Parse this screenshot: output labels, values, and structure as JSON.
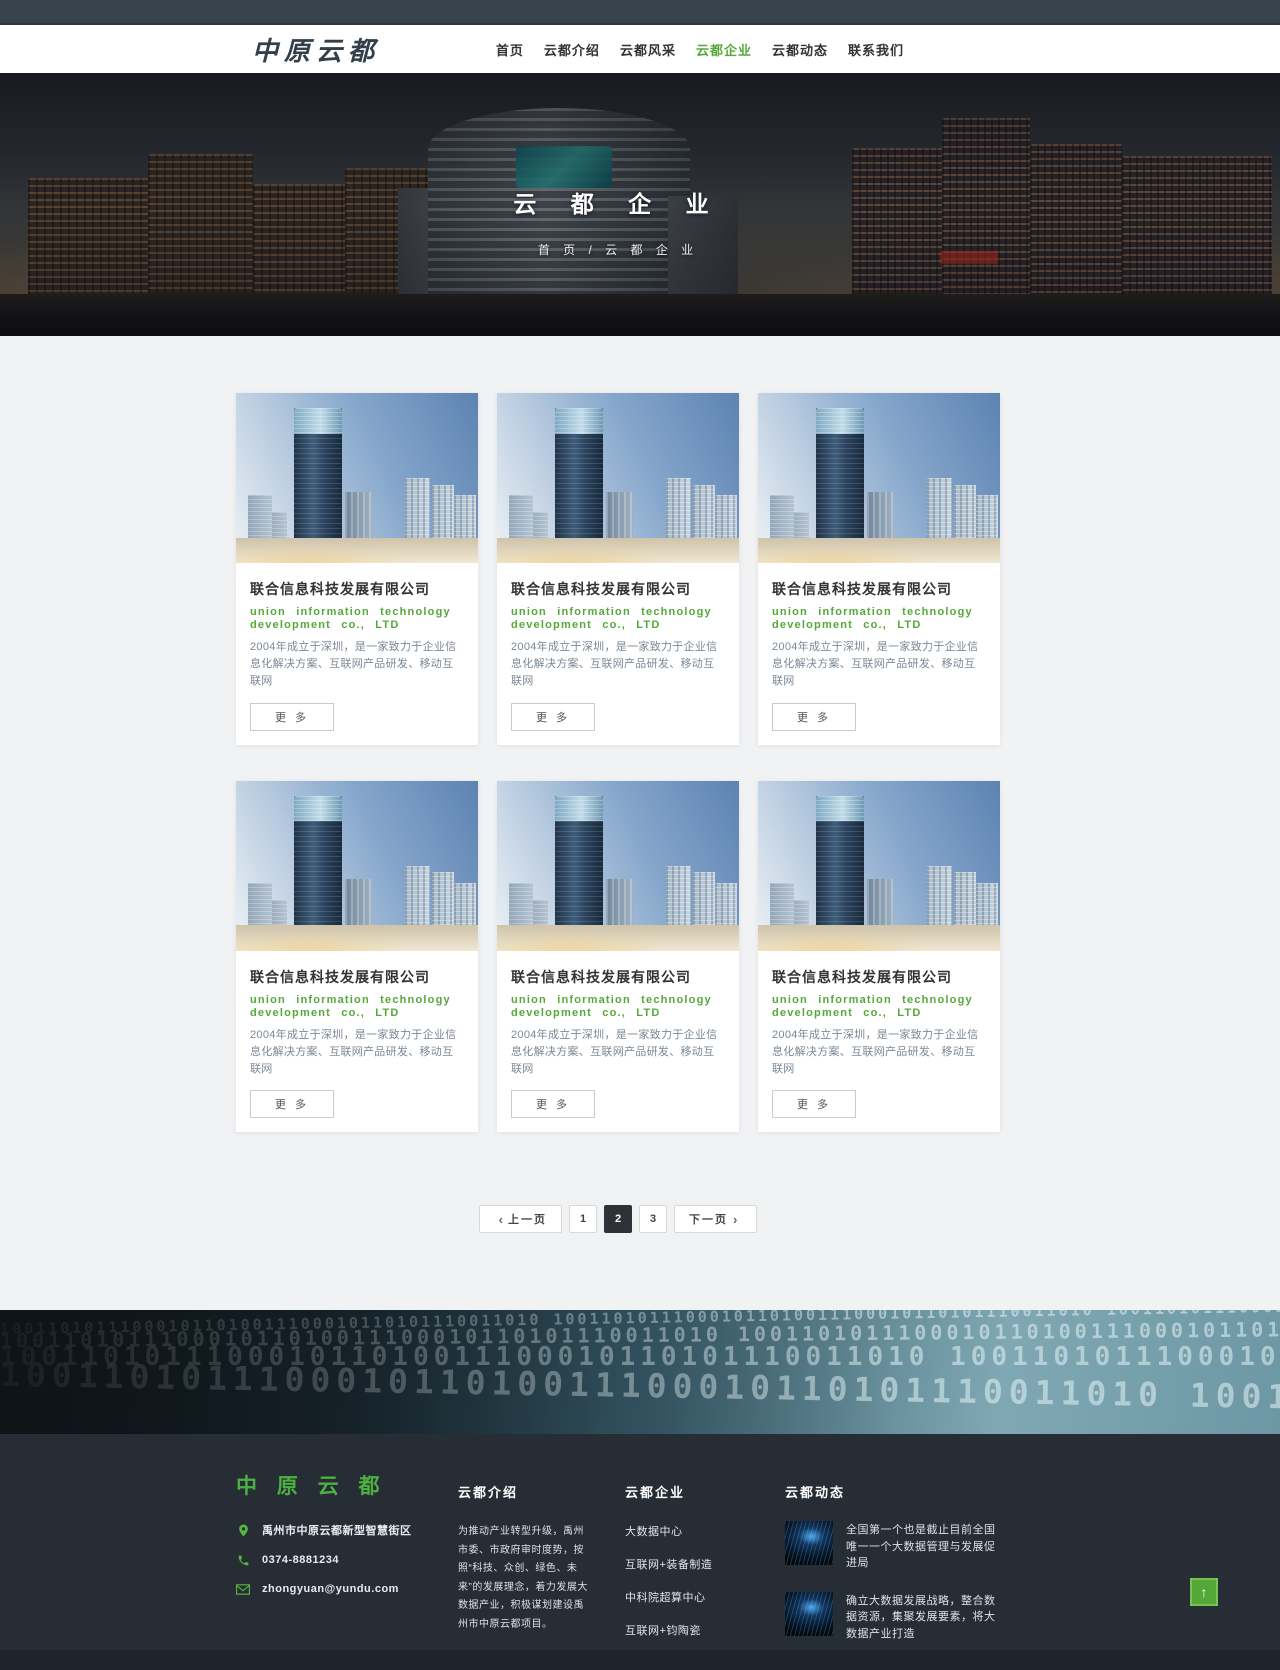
{
  "header": {
    "logo": "中原云都",
    "nav": [
      {
        "label": "首页",
        "active": false
      },
      {
        "label": "云都介绍",
        "active": false
      },
      {
        "label": "云都风采",
        "active": false
      },
      {
        "label": "云都企业",
        "active": true
      },
      {
        "label": "云都动态",
        "active": false
      },
      {
        "label": "联系我们",
        "active": false
      }
    ]
  },
  "hero": {
    "title": "云 都 企 业",
    "breadcrumb": "首 页 / 云 都 企 业"
  },
  "cards": [
    {
      "title": "联合信息科技发展有限公司",
      "subtitle_lines": [
        "union information technology",
        "development co., LTD"
      ],
      "description": "2004年成立于深圳，是一家致力于企业信息化解决方案、互联网产品研发、移动互联网",
      "more_label": "更 多"
    },
    {
      "title": "联合信息科技发展有限公司",
      "subtitle_lines": [
        "union information technology",
        "development co., LTD"
      ],
      "description": "2004年成立于深圳，是一家致力于企业信息化解决方案、互联网产品研发、移动互联网",
      "more_label": "更 多"
    },
    {
      "title": "联合信息科技发展有限公司",
      "subtitle_lines": [
        "union information technology",
        "development co., LTD"
      ],
      "description": "2004年成立于深圳，是一家致力于企业信息化解决方案、互联网产品研发、移动互联网",
      "more_label": "更 多"
    },
    {
      "title": "联合信息科技发展有限公司",
      "subtitle_lines": [
        "union information technology",
        "development co., LTD"
      ],
      "description": "2004年成立于深圳，是一家致力于企业信息化解决方案、互联网产品研发、移动互联网",
      "more_label": "更 多"
    },
    {
      "title": "联合信息科技发展有限公司",
      "subtitle_lines": [
        "union information technology",
        "development co., LTD"
      ],
      "description": "2004年成立于深圳，是一家致力于企业信息化解决方案、互联网产品研发、移动互联网",
      "more_label": "更 多"
    },
    {
      "title": "联合信息科技发展有限公司",
      "subtitle_lines": [
        "union information technology",
        "development co., LTD"
      ],
      "description": "2004年成立于深圳，是一家致力于企业信息化解决方案、互联网产品研发、移动互联网",
      "more_label": "更 多"
    }
  ],
  "pagination": {
    "prev_label": "上一页",
    "next_label": "下一页",
    "chevron_left": "‹",
    "chevron_right": "›",
    "pages": [
      "1",
      "2",
      "3"
    ],
    "active_page": "2"
  },
  "binary_banner": {
    "pattern": "100110101110001011010011100010110101110011010 "
  },
  "footer": {
    "brand": "中 原 云 都",
    "contact": {
      "address": "禹州市中原云都新型智慧街区",
      "phone": "0374-8881234",
      "email": "zhongyuan@yundu.com"
    },
    "about": {
      "heading": "云都介绍",
      "text": "为推动产业转型升级，禹州市委、市政府审时度势，按照“科技、众创、绿色、未来”的发展理念，着力发展大数据产业，积极谋划建设禹州市中原云都项目。"
    },
    "enterprises": {
      "heading": "云都企业",
      "links": [
        "大数据中心",
        "互联网+装备制造",
        "中科院超算中心",
        "互联网+钧陶瓷"
      ]
    },
    "news": {
      "heading": "云都动态",
      "items": [
        {
          "text": "全国第一个也是截止目前全国唯一一个大数据管理与发展促进局"
        },
        {
          "text": "确立大数据发展战略，整合数据资源，集聚发展要素，将大数据产业打造"
        }
      ]
    }
  },
  "backtop": {
    "arrow": "↑"
  },
  "colors": {
    "accent_green": "#55a93a",
    "footer_green": "#4cb141",
    "topbar": "#38434c",
    "footer_bg": "#262d35",
    "active_page_bg": "#2e3237"
  }
}
